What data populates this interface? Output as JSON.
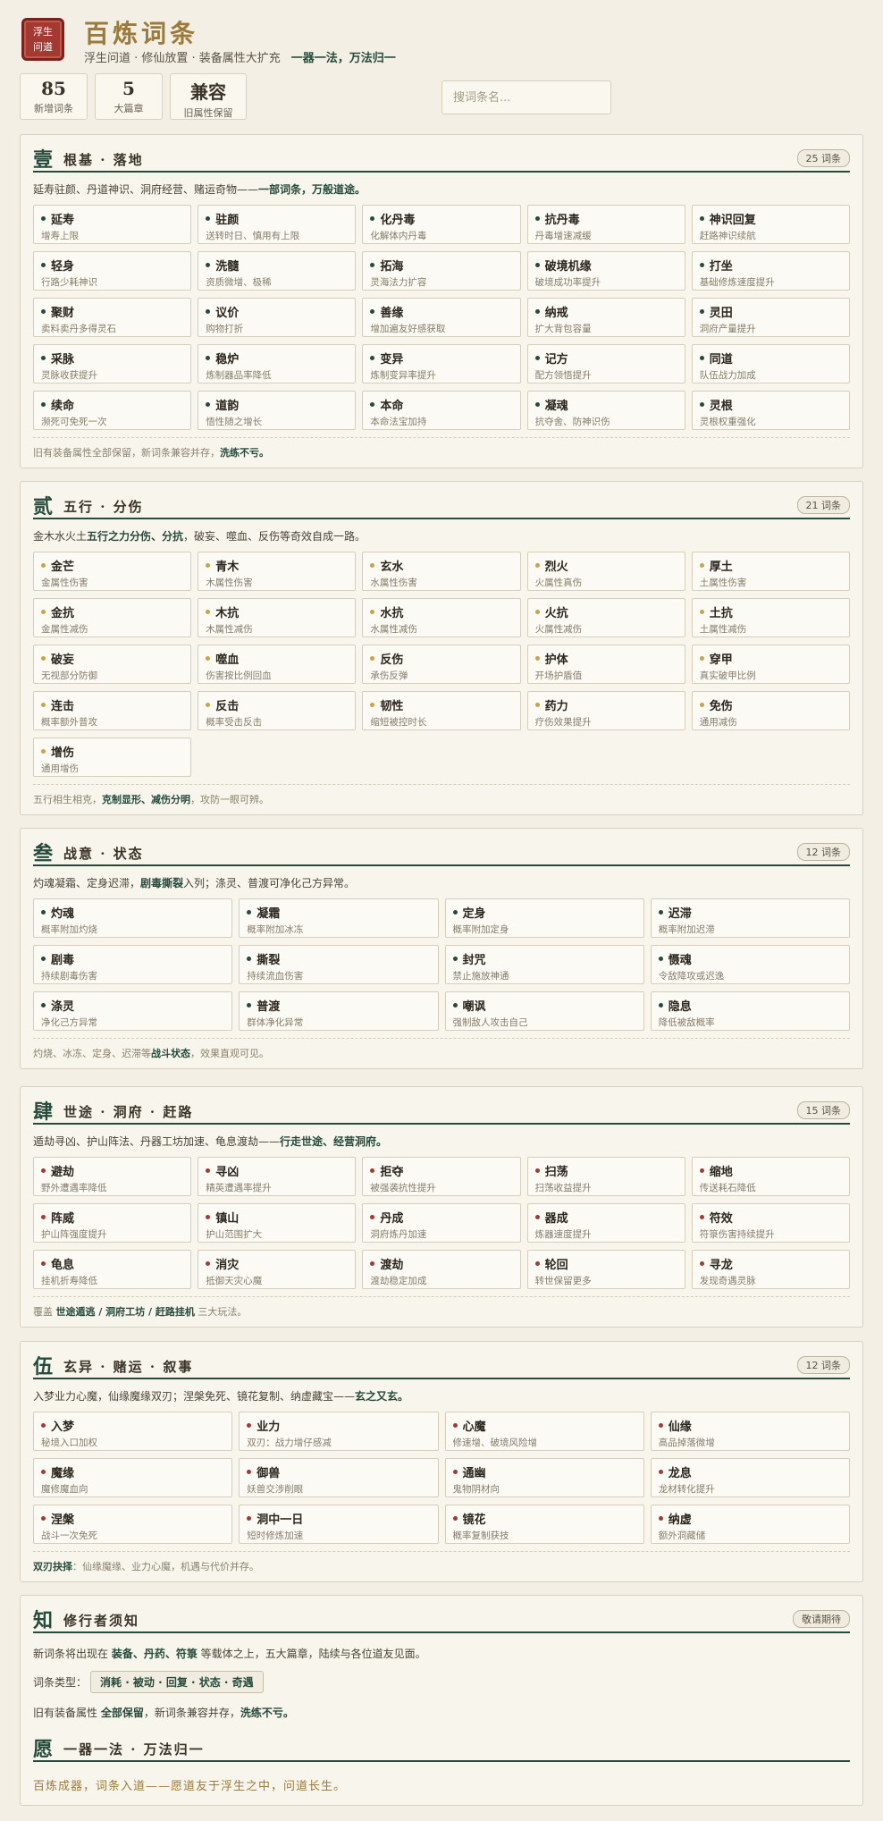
{
  "header": {
    "seal": [
      "浮生",
      "问道"
    ],
    "title": "百炼词条",
    "subtitle": "浮生问道 · 修仙放置 · 装备属性大扩充",
    "motto": "一器一法，万法归一"
  },
  "stats": [
    {
      "num": "85",
      "label": "新增词条"
    },
    {
      "num": "5",
      "label": "大篇章"
    },
    {
      "num": "兼容",
      "label": "旧属性保留"
    }
  ],
  "search": {
    "placeholder": "搜词条名..."
  },
  "colors": {
    "primary": "#264a3c",
    "gold": "#9c7a3c",
    "seal": "#a23a32",
    "dot_green": "#264a3c",
    "dot_gold": "#c9a24a",
    "dot_red": "#a23a32"
  },
  "sections": [
    {
      "num": "壹",
      "title": "根基 · 落地",
      "badge": "25 词条",
      "desc_pre": "延寿驻颜、丹道神识、洞府经营、赌运奇物——",
      "desc_bold": "一部词条，万般道途。",
      "desc_post": "",
      "dot": "green",
      "items": [
        {
          "name": "延寿",
          "desc": "增寿上限"
        },
        {
          "name": "驻颜",
          "desc": "送转时日、慎用有上限"
        },
        {
          "name": "化丹毒",
          "desc": "化解体内丹毒"
        },
        {
          "name": "抗丹毒",
          "desc": "丹毒增速减缓"
        },
        {
          "name": "神识回复",
          "desc": "赶路神识续航"
        },
        {
          "name": "轻身",
          "desc": "行路少耗神识"
        },
        {
          "name": "洗髓",
          "desc": "资质微增、极稀"
        },
        {
          "name": "拓海",
          "desc": "灵海法力扩容"
        },
        {
          "name": "破境机缘",
          "desc": "破境成功率提升"
        },
        {
          "name": "打坐",
          "desc": "基础修炼速度提升"
        },
        {
          "name": "聚财",
          "desc": "卖料卖丹多得灵石"
        },
        {
          "name": "议价",
          "desc": "购物打折"
        },
        {
          "name": "善缘",
          "desc": "增加遍友好感获取"
        },
        {
          "name": "纳戒",
          "desc": "扩大背包容量"
        },
        {
          "name": "灵田",
          "desc": "洞府产量提升"
        },
        {
          "name": "采脉",
          "desc": "灵脉收获提升"
        },
        {
          "name": "稳炉",
          "desc": "炼制器品率降低"
        },
        {
          "name": "变异",
          "desc": "炼制变异率提升"
        },
        {
          "name": "记方",
          "desc": "配方领悟提升"
        },
        {
          "name": "同道",
          "desc": "队伍战力加成"
        },
        {
          "name": "续命",
          "desc": "濒死可免死一次"
        },
        {
          "name": "道韵",
          "desc": "悟性随之增长"
        },
        {
          "name": "本命",
          "desc": "本命法宝加持"
        },
        {
          "name": "凝魂",
          "desc": "抗夺舍、防神识伤"
        },
        {
          "name": "灵根",
          "desc": "灵根权重强化"
        }
      ],
      "foot_pre": "旧有装备属性全部保留，新词条兼容并存，",
      "foot_bold": "洗练不亏。",
      "foot_post": ""
    },
    {
      "num": "贰",
      "title": "五行 · 分伤",
      "badge": "21 词条",
      "desc_pre": "金木水火土",
      "desc_bold": "五行之力分伤、分抗",
      "desc_post": "，破妄、噬血、反伤等奇效自成一路。",
      "dot": "gold",
      "items": [
        {
          "name": "金芒",
          "desc": "金属性伤害"
        },
        {
          "name": "青木",
          "desc": "木属性伤害"
        },
        {
          "name": "玄水",
          "desc": "水属性伤害"
        },
        {
          "name": "烈火",
          "desc": "火属性真伤"
        },
        {
          "name": "厚土",
          "desc": "土属性伤害"
        },
        {
          "name": "金抗",
          "desc": "金属性减伤"
        },
        {
          "name": "木抗",
          "desc": "木属性减伤"
        },
        {
          "name": "水抗",
          "desc": "水属性减伤"
        },
        {
          "name": "火抗",
          "desc": "火属性减伤"
        },
        {
          "name": "土抗",
          "desc": "土属性减伤"
        },
        {
          "name": "破妄",
          "desc": "无视部分防御"
        },
        {
          "name": "噬血",
          "desc": "伤害按比例回血"
        },
        {
          "name": "反伤",
          "desc": "承伤反弹"
        },
        {
          "name": "护体",
          "desc": "开场护盾值"
        },
        {
          "name": "穿甲",
          "desc": "真实破甲比例"
        },
        {
          "name": "连击",
          "desc": "概率额外普攻"
        },
        {
          "name": "反击",
          "desc": "概率受击反击"
        },
        {
          "name": "韧性",
          "desc": "缩短被控时长"
        },
        {
          "name": "药力",
          "desc": "疗伤效果提升"
        },
        {
          "name": "免伤",
          "desc": "通用减伤"
        },
        {
          "name": "增伤",
          "desc": "通用增伤"
        }
      ],
      "foot_pre": "五行相生相克，",
      "foot_bold": "克制显形、减伤分明",
      "foot_post": "，攻防一眼可辨。"
    },
    {
      "num": "叁",
      "title": "战意 · 状态",
      "badge": "12 词条",
      "desc_pre": "灼魂凝霜、定身迟滞，",
      "desc_bold": "剧毒撕裂",
      "desc_post": "入列；涤灵、普渡可净化己方异常。",
      "dot": "green",
      "items": [
        {
          "name": "灼魂",
          "desc": "概率附加灼烧"
        },
        {
          "name": "凝霜",
          "desc": "概率附加冰冻"
        },
        {
          "name": "定身",
          "desc": "概率附加定身"
        },
        {
          "name": "迟滞",
          "desc": "概率附加迟滞"
        },
        {
          "name": "剧毒",
          "desc": "持续剧毒伤害"
        },
        {
          "name": "撕裂",
          "desc": "持续流血伤害"
        },
        {
          "name": "封咒",
          "desc": "禁止施放神通"
        },
        {
          "name": "慑魂",
          "desc": "令敌降攻或迟逸"
        },
        {
          "name": "涤灵",
          "desc": "净化己方异常"
        },
        {
          "name": "普渡",
          "desc": "群体净化异常"
        },
        {
          "name": "嘲讽",
          "desc": "强制敌人攻击自己"
        },
        {
          "name": "隐息",
          "desc": "降低被敌概率"
        }
      ],
      "foot_pre": "灼烧、冰冻、定身、迟滞等",
      "foot_bold": "战斗状态",
      "foot_post": "，效果直观可见。"
    },
    {
      "num": "肆",
      "title": "世途 · 洞府 · 赶路",
      "badge": "15 词条",
      "desc_pre": "遁劫寻凶、护山阵法、丹器工坊加速、龟息渡劫——",
      "desc_bold": "行走世途、经营洞府。",
      "desc_post": "",
      "dot": "red",
      "items": [
        {
          "name": "避劫",
          "desc": "野外遭遇率降低"
        },
        {
          "name": "寻凶",
          "desc": "精英遭遇率提升"
        },
        {
          "name": "拒夺",
          "desc": "被强袭抗性提升"
        },
        {
          "name": "扫荡",
          "desc": "扫荡收益提升"
        },
        {
          "name": "缩地",
          "desc": "传送耗石降低"
        },
        {
          "name": "阵威",
          "desc": "护山阵强度提升"
        },
        {
          "name": "镇山",
          "desc": "护山范围扩大"
        },
        {
          "name": "丹成",
          "desc": "洞府炼丹加速"
        },
        {
          "name": "器成",
          "desc": "炼器速度提升"
        },
        {
          "name": "符效",
          "desc": "符箓伤害持续提升"
        },
        {
          "name": "龟息",
          "desc": "挂机折寿降低"
        },
        {
          "name": "消灾",
          "desc": "抵御天灾心魔"
        },
        {
          "name": "渡劫",
          "desc": "渡劫稳定加成"
        },
        {
          "name": "轮回",
          "desc": "转世保留更多"
        },
        {
          "name": "寻龙",
          "desc": "发现奇遇灵脉"
        }
      ],
      "foot_pre": "覆盖 ",
      "foot_bold": "世途遁逃 / 洞府工坊 / 赶路挂机",
      "foot_post": " 三大玩法。"
    },
    {
      "num": "伍",
      "title": "玄异 · 赌运 · 叙事",
      "badge": "12 词条",
      "desc_pre": "入梦业力心魔，仙缘魔缘双刃；涅槃免死、镜花复制、纳虚藏宝——",
      "desc_bold": "玄之又玄。",
      "desc_post": "",
      "dot": "red",
      "items": [
        {
          "name": "入梦",
          "desc": "秘境入口加权"
        },
        {
          "name": "业力",
          "desc": "双刃：战力增仔感减"
        },
        {
          "name": "心魔",
          "desc": "修速增、破境风险增"
        },
        {
          "name": "仙缘",
          "desc": "高品掉落微增"
        },
        {
          "name": "魔缘",
          "desc": "魔修魔血向"
        },
        {
          "name": "御兽",
          "desc": "妖兽交涉削眼"
        },
        {
          "name": "通幽",
          "desc": "鬼物阴材向"
        },
        {
          "name": "龙息",
          "desc": "龙材转化提升"
        },
        {
          "name": "涅槃",
          "desc": "战斗一次免死"
        },
        {
          "name": "洞中一日",
          "desc": "短时修炼加速"
        },
        {
          "name": "镜花",
          "desc": "概率复制获技"
        },
        {
          "name": "纳虚",
          "desc": "额外洞藏储"
        }
      ],
      "foot_pre": "",
      "foot_bold": "双刃抉择",
      "foot_post": "：仙缘魔缘、业力心魔，机遇与代价并存。"
    }
  ],
  "notice": {
    "num": "知",
    "title": "修行者须知",
    "badge": "敬请期待",
    "p1_pre": "新词条将出现在 ",
    "p1_bold": "装备、丹药、符箓",
    "p1_post": " 等载体之上，五大篇章，陆续与各位道友见面。",
    "types_label": "词条类型：",
    "types": "消耗 · 被动 · 回复 · 状态 · 奇遇",
    "p3_pre": "旧有装备属性 ",
    "p3_bold1": "全部保留",
    "p3_mid": "，新词条兼容并存，",
    "p3_bold2": "洗练不亏。",
    "vow_num": "愿",
    "vow_title": "一器一法 · 万法归一",
    "vow_line": "百炼成器，词条入道——愿道友于浮生之中，问道长生。"
  }
}
